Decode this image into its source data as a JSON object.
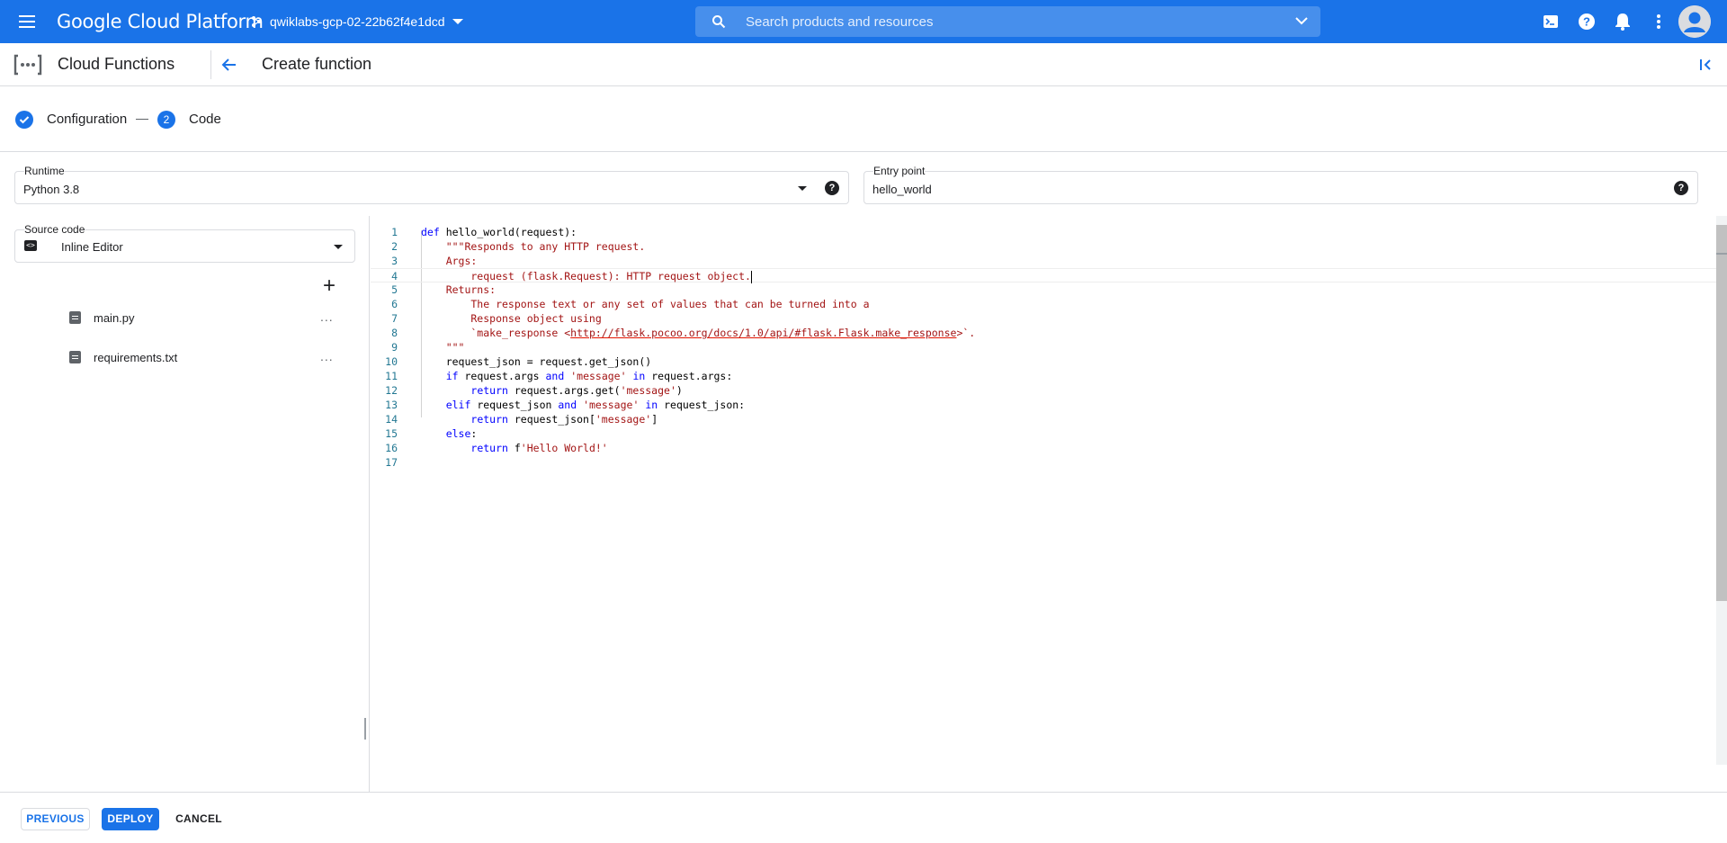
{
  "topbar": {
    "brand": "Google Cloud Platform",
    "project": "qwiklabs-gcp-02-22b62f4e1dcd",
    "search_placeholder": "Search products and resources",
    "icons": [
      "menu-icon",
      "project-icon",
      "search-icon",
      "chevron-down-icon",
      "cloud-shell-icon",
      "help-icon",
      "notifications-icon",
      "more-vert-icon",
      "avatar"
    ]
  },
  "subheader": {
    "product": "Cloud Functions",
    "page_title": "Create function"
  },
  "stepper": {
    "step1": "Configuration",
    "step2_num": "2",
    "step2": "Code"
  },
  "runtime": {
    "label": "Runtime",
    "value": "Python 3.8"
  },
  "entry_point": {
    "label": "Entry point",
    "value": "hello_world"
  },
  "source": {
    "label": "Source code",
    "value": "Inline Editor",
    "files": [
      {
        "name": "main.py"
      },
      {
        "name": "requirements.txt"
      }
    ]
  },
  "editor": {
    "language": "python",
    "lines": [
      "def hello_world(request):",
      "    \"\"\"Responds to any HTTP request.",
      "    Args:",
      "        request (flask.Request): HTTP request object.",
      "    Returns:",
      "        The response text or any set of values that can be turned into a",
      "        Response object using",
      "        `make_response <http://flask.pocoo.org/docs/1.0/api/#flask.Flask.make_response>`.",
      "    \"\"\"",
      "    request_json = request.get_json()",
      "    if request.args and 'message' in request.args:",
      "        return request.args.get('message')",
      "    elif request_json and 'message' in request_json:",
      "        return request_json['message']",
      "    else:",
      "        return f'Hello World!'",
      ""
    ],
    "link_text": "http://flask.pocoo.org/docs/1.0/api/#flask.Flask.make_response"
  },
  "footer": {
    "previous": "PREVIOUS",
    "deploy": "DEPLOY",
    "cancel": "CANCEL"
  },
  "colors": {
    "brand_blue": "#1a73e8",
    "keyword": "#0000ff",
    "string": "#a31515",
    "line_number": "#237893"
  }
}
